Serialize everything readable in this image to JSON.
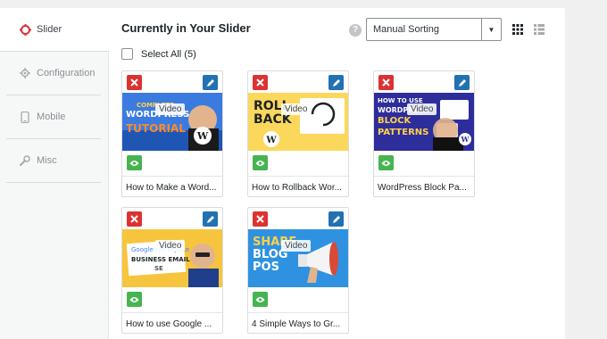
{
  "sidebar": {
    "items": [
      {
        "label": "Slider",
        "icon": "slider-icon",
        "active": true
      },
      {
        "label": "Configuration",
        "icon": "gear-icon",
        "active": false
      },
      {
        "label": "Mobile",
        "icon": "mobile-icon",
        "active": false
      },
      {
        "label": "Misc",
        "icon": "wrench-icon",
        "active": false
      }
    ]
  },
  "header": {
    "title": "Currently in Your Slider",
    "help_icon": "?",
    "sort": {
      "selected": "Manual Sorting"
    }
  },
  "select_all": {
    "label": "Select All (5)"
  },
  "slides": [
    {
      "caption": "How to Make a Word...",
      "overlay": "Video",
      "thumb_text": [
        "COMPLETE",
        "WORDPRESS",
        "TUTORIAL"
      ]
    },
    {
      "caption": "How to Rollback Wor...",
      "overlay": "Video",
      "thumb_text": [
        "ROLL",
        "BACK"
      ]
    },
    {
      "caption": "WordPress Block Pa...",
      "overlay": "Video",
      "thumb_text": [
        "HOW TO USE",
        "WORDPRESS",
        "BLOCK",
        "PATTERNS"
      ]
    },
    {
      "caption": "How to use Google ...",
      "overlay": "Video",
      "thumb_text": [
        "Google Workspace",
        "BUSINESS EMAIL",
        "SE"
      ]
    },
    {
      "caption": "4 Simple Ways to Gr...",
      "overlay": "Video",
      "thumb_text": [
        "SHARE",
        "BLOG",
        "POS"
      ]
    }
  ],
  "colors": {
    "delete": "#dc3232",
    "edit": "#2271b1",
    "visible": "#46b450",
    "accent": "#d63638"
  }
}
